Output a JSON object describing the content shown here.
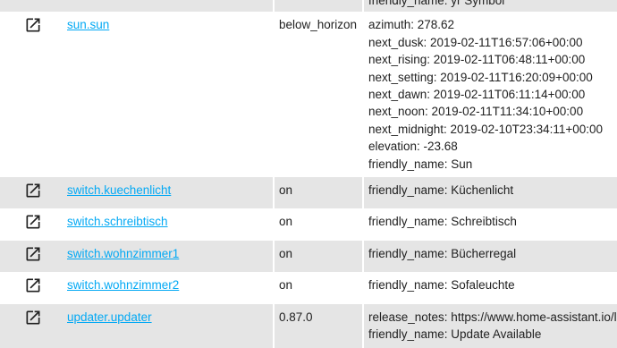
{
  "rows": [
    {
      "entity": "",
      "state": "",
      "attributes": [
        "friendly_name: yr Symbol"
      ],
      "partial": true
    },
    {
      "entity": "sun.sun",
      "state": "below_horizon",
      "attributes": [
        "azimuth: 278.62",
        "next_dusk: 2019-02-11T16:57:06+00:00",
        "next_rising: 2019-02-11T06:48:11+00:00",
        "next_setting: 2019-02-11T16:20:09+00:00",
        "next_dawn: 2019-02-11T06:11:14+00:00",
        "next_noon: 2019-02-11T11:34:10+00:00",
        "next_midnight: 2019-02-10T23:34:11+00:00",
        "elevation: -23.68",
        "friendly_name: Sun"
      ]
    },
    {
      "entity": "switch.kuechenlicht",
      "state": "on",
      "attributes": [
        "friendly_name: Küchenlicht"
      ]
    },
    {
      "entity": "switch.schreibtisch",
      "state": "on",
      "attributes": [
        "friendly_name: Schreibtisch"
      ]
    },
    {
      "entity": "switch.wohnzimmer1",
      "state": "on",
      "attributes": [
        "friendly_name: Bücherregal"
      ]
    },
    {
      "entity": "switch.wohnzimmer2",
      "state": "on",
      "attributes": [
        "friendly_name: Sofaleuchte"
      ]
    },
    {
      "entity": "updater.updater",
      "state": "0.87.0",
      "attributes": [
        "release_notes: https://www.home-assistant.io/la",
        "friendly_name: Update Available"
      ]
    }
  ],
  "icons": {
    "row_icon": "open-in-new-icon"
  },
  "colors": {
    "link": "#03a9f4",
    "row_shade": "#e5e5e5"
  }
}
